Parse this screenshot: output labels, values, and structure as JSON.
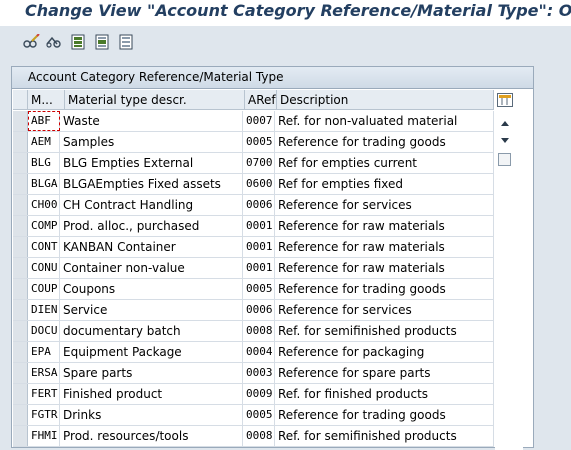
{
  "window": {
    "title": "Change View \"Account Category Reference/Material Type\": Over"
  },
  "toolbar": {
    "icons": [
      "glasses-pencil-icon",
      "display-change-icon",
      "select-all-icon",
      "select-block-icon",
      "deselect-all-icon"
    ]
  },
  "panel": {
    "title": "Account Category Reference/Material Type",
    "columns": {
      "key": "M...",
      "desc": "Material type descr.",
      "aref": "ARef",
      "text": "Description"
    },
    "rows": [
      {
        "key": "ABF",
        "desc": "Waste",
        "aref": "0007",
        "text": "Ref. for non-valuated material"
      },
      {
        "key": "AEM",
        "desc": "Samples",
        "aref": "0005",
        "text": "Reference for trading goods"
      },
      {
        "key": "BLG",
        "desc": "BLG Empties  External",
        "aref": "0700",
        "text": "Ref for empties current"
      },
      {
        "key": "BLGA",
        "desc": "BLGAEmpties  Fixed assets",
        "aref": "0600",
        "text": "Ref for empties fixed"
      },
      {
        "key": "CH00",
        "desc": "CH Contract Handling",
        "aref": "0006",
        "text": "Reference for services"
      },
      {
        "key": "COMP",
        "desc": "Prod. alloc., purchased",
        "aref": "0001",
        "text": "Reference for raw materials"
      },
      {
        "key": "CONT",
        "desc": "KANBAN Container",
        "aref": "0001",
        "text": "Reference for raw materials"
      },
      {
        "key": "CONU",
        "desc": "Container non-value",
        "aref": "0001",
        "text": "Reference for raw materials"
      },
      {
        "key": "COUP",
        "desc": "Coupons",
        "aref": "0005",
        "text": "Reference for trading goods"
      },
      {
        "key": "DIEN",
        "desc": "Service",
        "aref": "0006",
        "text": "Reference for services"
      },
      {
        "key": "DOCU",
        "desc": "documentary batch",
        "aref": "0008",
        "text": "Ref. for semifinished products"
      },
      {
        "key": "EPA",
        "desc": "Equipment Package",
        "aref": "0004",
        "text": "Reference for packaging"
      },
      {
        "key": "ERSA",
        "desc": "Spare parts",
        "aref": "0003",
        "text": "Reference for spare parts"
      },
      {
        "key": "FERT",
        "desc": "Finished product",
        "aref": "0009",
        "text": "Ref. for finished products"
      },
      {
        "key": "FGTR",
        "desc": "Drinks",
        "aref": "0005",
        "text": "Reference for trading goods"
      },
      {
        "key": "FHMI",
        "desc": "Prod. resources/tools",
        "aref": "0008",
        "text": "Ref. for semifinished products"
      }
    ]
  },
  "colors": {
    "title_text": "#233f61",
    "background": "#dfe6ed",
    "focus_outline": "#cc0000"
  }
}
